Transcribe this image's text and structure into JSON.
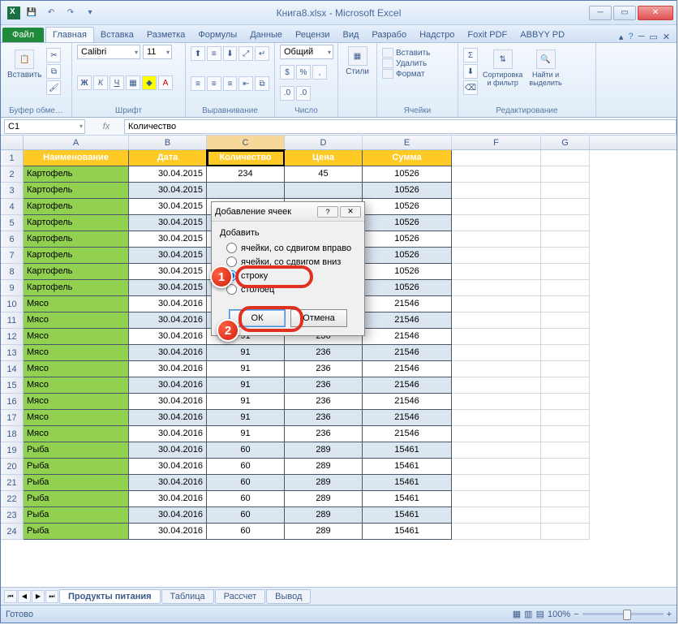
{
  "window": {
    "title": "Книга8.xlsx - Microsoft Excel"
  },
  "tabs": {
    "file": "Файл",
    "items": [
      "Главная",
      "Вставка",
      "Разметка",
      "Формулы",
      "Данные",
      "Рецензи",
      "Вид",
      "Разрабо",
      "Надстро",
      "Foxit PDF",
      "ABBYY PD"
    ],
    "active": 0
  },
  "ribbon": {
    "clipboard": {
      "paste": "Вставить",
      "label": "Буфер обме…"
    },
    "font": {
      "name": "Calibri",
      "size": "11",
      "label": "Шрифт"
    },
    "alignment": {
      "label": "Выравнивание"
    },
    "number": {
      "format": "Общий",
      "label": "Число"
    },
    "styles": {
      "btn": "Стили"
    },
    "cells": {
      "insert": "Вставить",
      "delete": "Удалить",
      "format": "Формат",
      "label": "Ячейки"
    },
    "editing": {
      "sort": "Сортировка\nи фильтр",
      "find": "Найти и\nвыделить",
      "label": "Редактирование"
    }
  },
  "formula": {
    "name_box": "C1",
    "value": "Количество"
  },
  "columns": [
    "A",
    "B",
    "C",
    "D",
    "E",
    "F",
    "G"
  ],
  "headers": [
    "Наименование",
    "Дата",
    "Количество",
    "Цена",
    "Сумма"
  ],
  "rows": [
    {
      "n": 2,
      "a": "Картофель",
      "b": "30.04.2015",
      "c": "234",
      "d": "45",
      "e": "10526",
      "alt": false
    },
    {
      "n": 3,
      "a": "Картофель",
      "b": "30.04.2015",
      "c": "",
      "d": "",
      "e": "10526",
      "alt": true
    },
    {
      "n": 4,
      "a": "Картофель",
      "b": "30.04.2015",
      "c": "",
      "d": "",
      "e": "10526",
      "alt": false
    },
    {
      "n": 5,
      "a": "Картофель",
      "b": "30.04.2015",
      "c": "",
      "d": "",
      "e": "10526",
      "alt": true
    },
    {
      "n": 6,
      "a": "Картофель",
      "b": "30.04.2015",
      "c": "",
      "d": "",
      "e": "10526",
      "alt": false
    },
    {
      "n": 7,
      "a": "Картофель",
      "b": "30.04.2015",
      "c": "",
      "d": "",
      "e": "10526",
      "alt": true
    },
    {
      "n": 8,
      "a": "Картофель",
      "b": "30.04.2015",
      "c": "",
      "d": "",
      "e": "10526",
      "alt": false
    },
    {
      "n": 9,
      "a": "Картофель",
      "b": "30.04.2015",
      "c": "",
      "d": "",
      "e": "10526",
      "alt": true
    },
    {
      "n": 10,
      "a": "Мясо",
      "b": "30.04.2016",
      "c": "",
      "d": "",
      "e": "21546",
      "alt": false
    },
    {
      "n": 11,
      "a": "Мясо",
      "b": "30.04.2016",
      "c": "",
      "d": "",
      "e": "21546",
      "alt": true
    },
    {
      "n": 12,
      "a": "Мясо",
      "b": "30.04.2016",
      "c": "91",
      "d": "236",
      "e": "21546",
      "alt": false
    },
    {
      "n": 13,
      "a": "Мясо",
      "b": "30.04.2016",
      "c": "91",
      "d": "236",
      "e": "21546",
      "alt": true
    },
    {
      "n": 14,
      "a": "Мясо",
      "b": "30.04.2016",
      "c": "91",
      "d": "236",
      "e": "21546",
      "alt": false
    },
    {
      "n": 15,
      "a": "Мясо",
      "b": "30.04.2016",
      "c": "91",
      "d": "236",
      "e": "21546",
      "alt": true
    },
    {
      "n": 16,
      "a": "Мясо",
      "b": "30.04.2016",
      "c": "91",
      "d": "236",
      "e": "21546",
      "alt": false
    },
    {
      "n": 17,
      "a": "Мясо",
      "b": "30.04.2016",
      "c": "91",
      "d": "236",
      "e": "21546",
      "alt": true
    },
    {
      "n": 18,
      "a": "Мясо",
      "b": "30.04.2016",
      "c": "91",
      "d": "236",
      "e": "21546",
      "alt": false
    },
    {
      "n": 19,
      "a": "Рыба",
      "b": "30.04.2016",
      "c": "60",
      "d": "289",
      "e": "15461",
      "alt": true
    },
    {
      "n": 20,
      "a": "Рыба",
      "b": "30.04.2016",
      "c": "60",
      "d": "289",
      "e": "15461",
      "alt": false
    },
    {
      "n": 21,
      "a": "Рыба",
      "b": "30.04.2016",
      "c": "60",
      "d": "289",
      "e": "15461",
      "alt": true
    },
    {
      "n": 22,
      "a": "Рыба",
      "b": "30.04.2016",
      "c": "60",
      "d": "289",
      "e": "15461",
      "alt": false
    },
    {
      "n": 23,
      "a": "Рыба",
      "b": "30.04.2016",
      "c": "60",
      "d": "289",
      "e": "15461",
      "alt": true
    },
    {
      "n": 24,
      "a": "Рыба",
      "b": "30.04.2016",
      "c": "60",
      "d": "289",
      "e": "15461",
      "alt": false
    }
  ],
  "sheets": {
    "active": "Продукты питания",
    "others": [
      "Таблица",
      "Рассчет",
      "Вывод"
    ]
  },
  "status": {
    "ready": "Готово",
    "zoom": "100%"
  },
  "dialog": {
    "title": "Добавление ячеек",
    "group": "Добавить",
    "opts": [
      "ячейки, со сдвигом вправо",
      "ячейки, со сдвигом вниз",
      "строку",
      "столбец"
    ],
    "selected": 2,
    "ok": "ОК",
    "cancel": "Отмена"
  },
  "markers": {
    "m1": "1",
    "m2": "2"
  }
}
